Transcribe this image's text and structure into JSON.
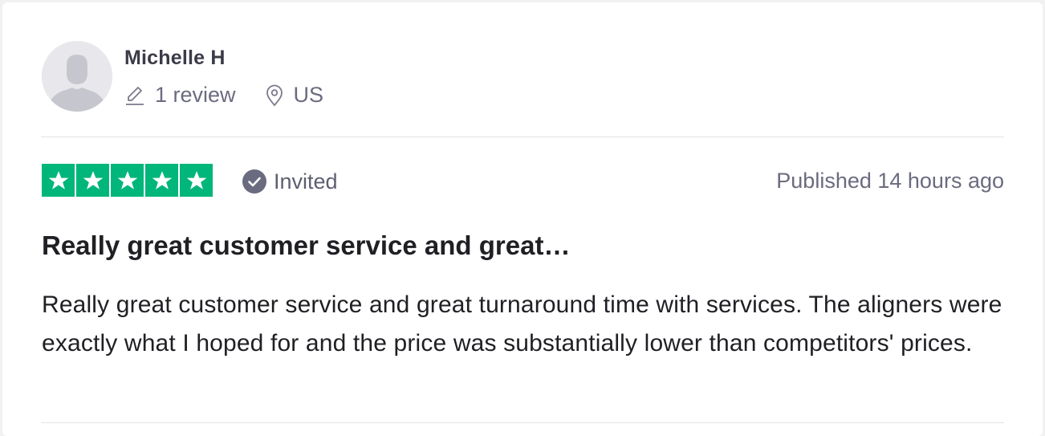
{
  "user": {
    "name": "Michelle H",
    "reviews": "1 review",
    "location": "US"
  },
  "rating": {
    "stars": 5,
    "max": 5,
    "color": "#00b67a",
    "invited_label": "Invited",
    "published": "Published 14 hours ago"
  },
  "review": {
    "title": "Really great customer service and great…",
    "body": "Really great customer service and great turnaround time with services. The aligners were exactly what I hoped for and the price was substantially lower than competitors' prices."
  },
  "icons": {
    "avatar": "user-avatar-icon",
    "reviews": "pencil-icon",
    "location": "map-pin-icon",
    "invited": "checkmark-badge-icon",
    "star": "star-icon"
  }
}
